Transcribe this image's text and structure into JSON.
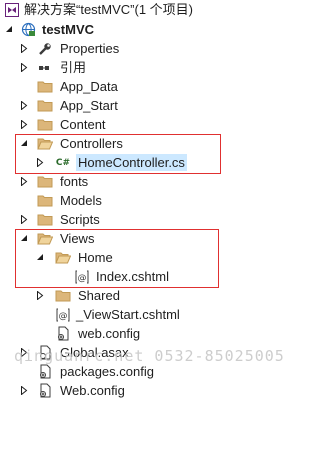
{
  "solution": {
    "label": "解决方案“testMVC”(1 个项目)"
  },
  "project": {
    "label": "testMVC"
  },
  "items": {
    "properties": "Properties",
    "references": "引用",
    "app_data": "App_Data",
    "app_start": "App_Start",
    "content": "Content",
    "controllers": "Controllers",
    "home_controller": "HomeController.cs",
    "fonts": "fonts",
    "models": "Models",
    "scripts": "Scripts",
    "views": "Views",
    "home": "Home",
    "index": "Index.cshtml",
    "shared": "Shared",
    "viewstart": "_ViewStart.cshtml",
    "views_webconfig": "web.config",
    "global_asax": "Global.asax",
    "packages_config": "packages.config",
    "web_config": "Web.config"
  },
  "watermark": "qinguanrc.net 0532-85025005",
  "colors": {
    "highlight_box": "#e03030",
    "folder": "#dcb67a",
    "selection": "#cce8ff"
  }
}
